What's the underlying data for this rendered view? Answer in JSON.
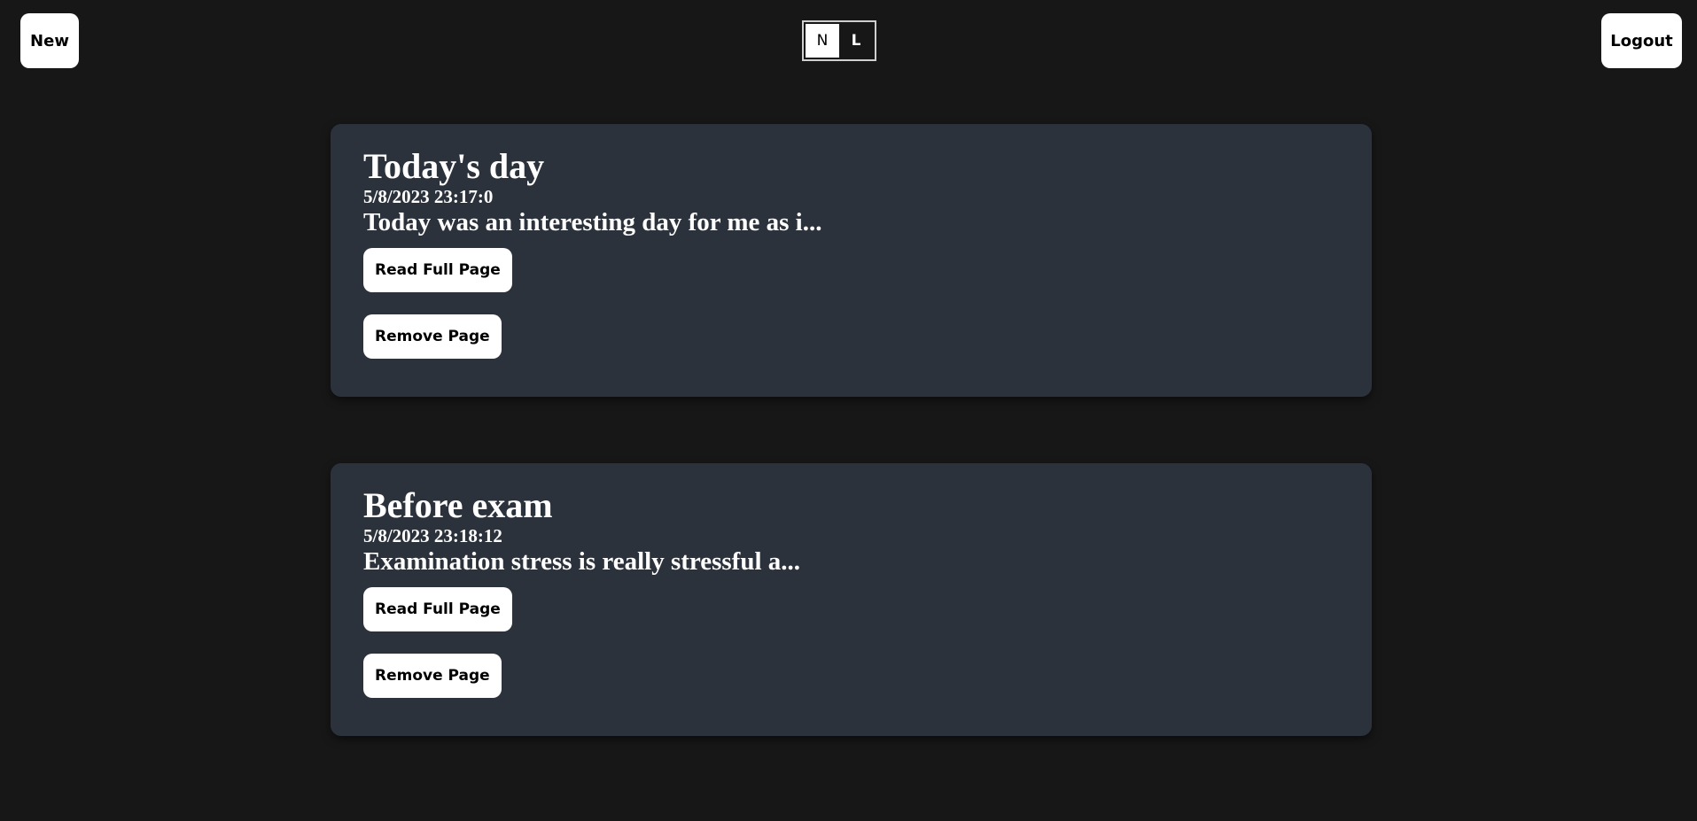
{
  "header": {
    "new_label": "New",
    "logout_label": "Logout",
    "logo": {
      "left": "N",
      "right": "L"
    }
  },
  "entries": [
    {
      "title": "Today's day",
      "date": "5/8/2023 23:17:0",
      "snippet": "Today was an interesting day for me as i...",
      "read_label": "Read Full Page",
      "remove_label": "Remove Page"
    },
    {
      "title": "Before exam",
      "date": "5/8/2023 23:18:12",
      "snippet": "Examination stress is really stressful a...",
      "read_label": "Read Full Page",
      "remove_label": "Remove Page"
    }
  ],
  "colors": {
    "background": "#171717",
    "card": "#2c323c",
    "button": "#ffffff",
    "text": "#ffffff"
  }
}
